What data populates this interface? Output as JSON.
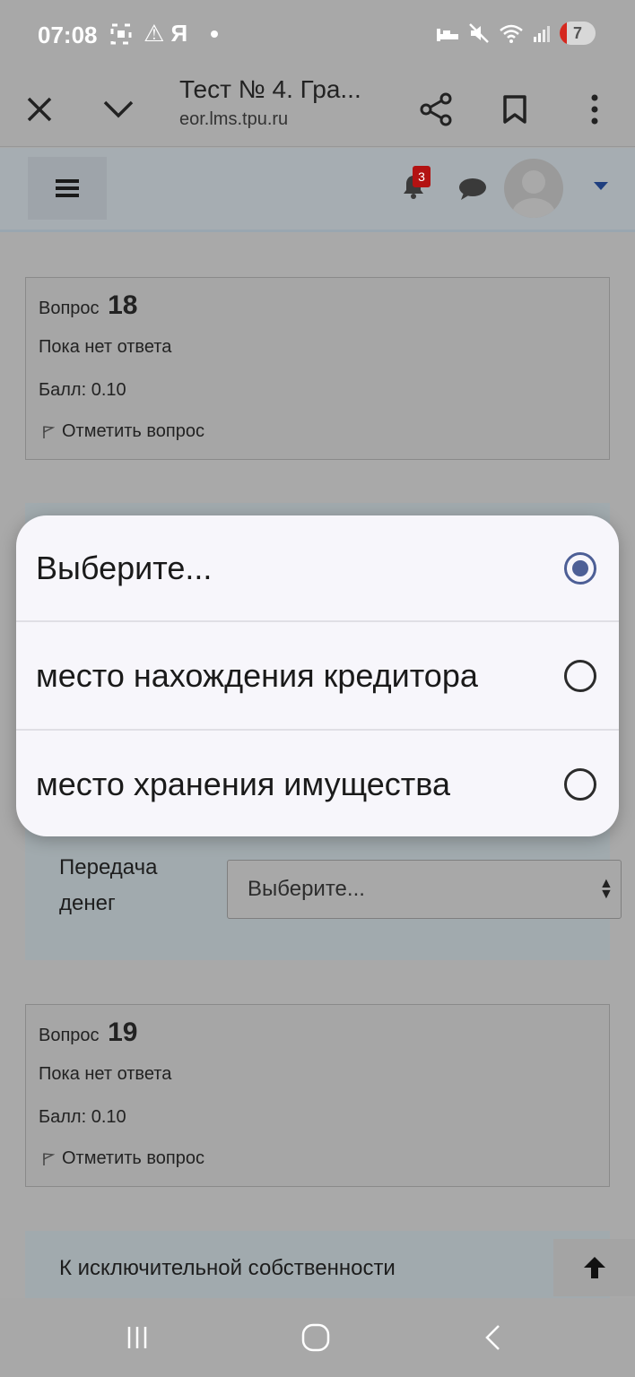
{
  "status_bar": {
    "time": "07:08",
    "left_glyphs": "⚠ Я",
    "battery_level": "7"
  },
  "browser": {
    "title": "Тест № 4. Гра...",
    "url": "eor.lms.tpu.ru"
  },
  "navbar": {
    "notification_count": "3"
  },
  "questions": [
    {
      "label": "Вопрос",
      "number": "18",
      "state": "Пока нет ответа",
      "grade": "Балл: 0.10",
      "flag": "Отметить вопрос"
    },
    {
      "label": "Вопрос",
      "number": "19",
      "state": "Пока нет ответа",
      "grade": "Балл: 0.10",
      "flag": "Отметить вопрос"
    }
  ],
  "match": {
    "label_line1": "Передача",
    "label_line2": "денег",
    "selected": "Выберите..."
  },
  "next_question_text": "К исключительной собственности",
  "popup": {
    "options": [
      {
        "label": "Выберите...",
        "selected": true
      },
      {
        "label": "место нахождения кредитора",
        "selected": false
      },
      {
        "label": "место хранения имущества",
        "selected": false
      }
    ]
  },
  "colors": {
    "radio_selected": "#4d5f96",
    "badge": "#b31212"
  }
}
